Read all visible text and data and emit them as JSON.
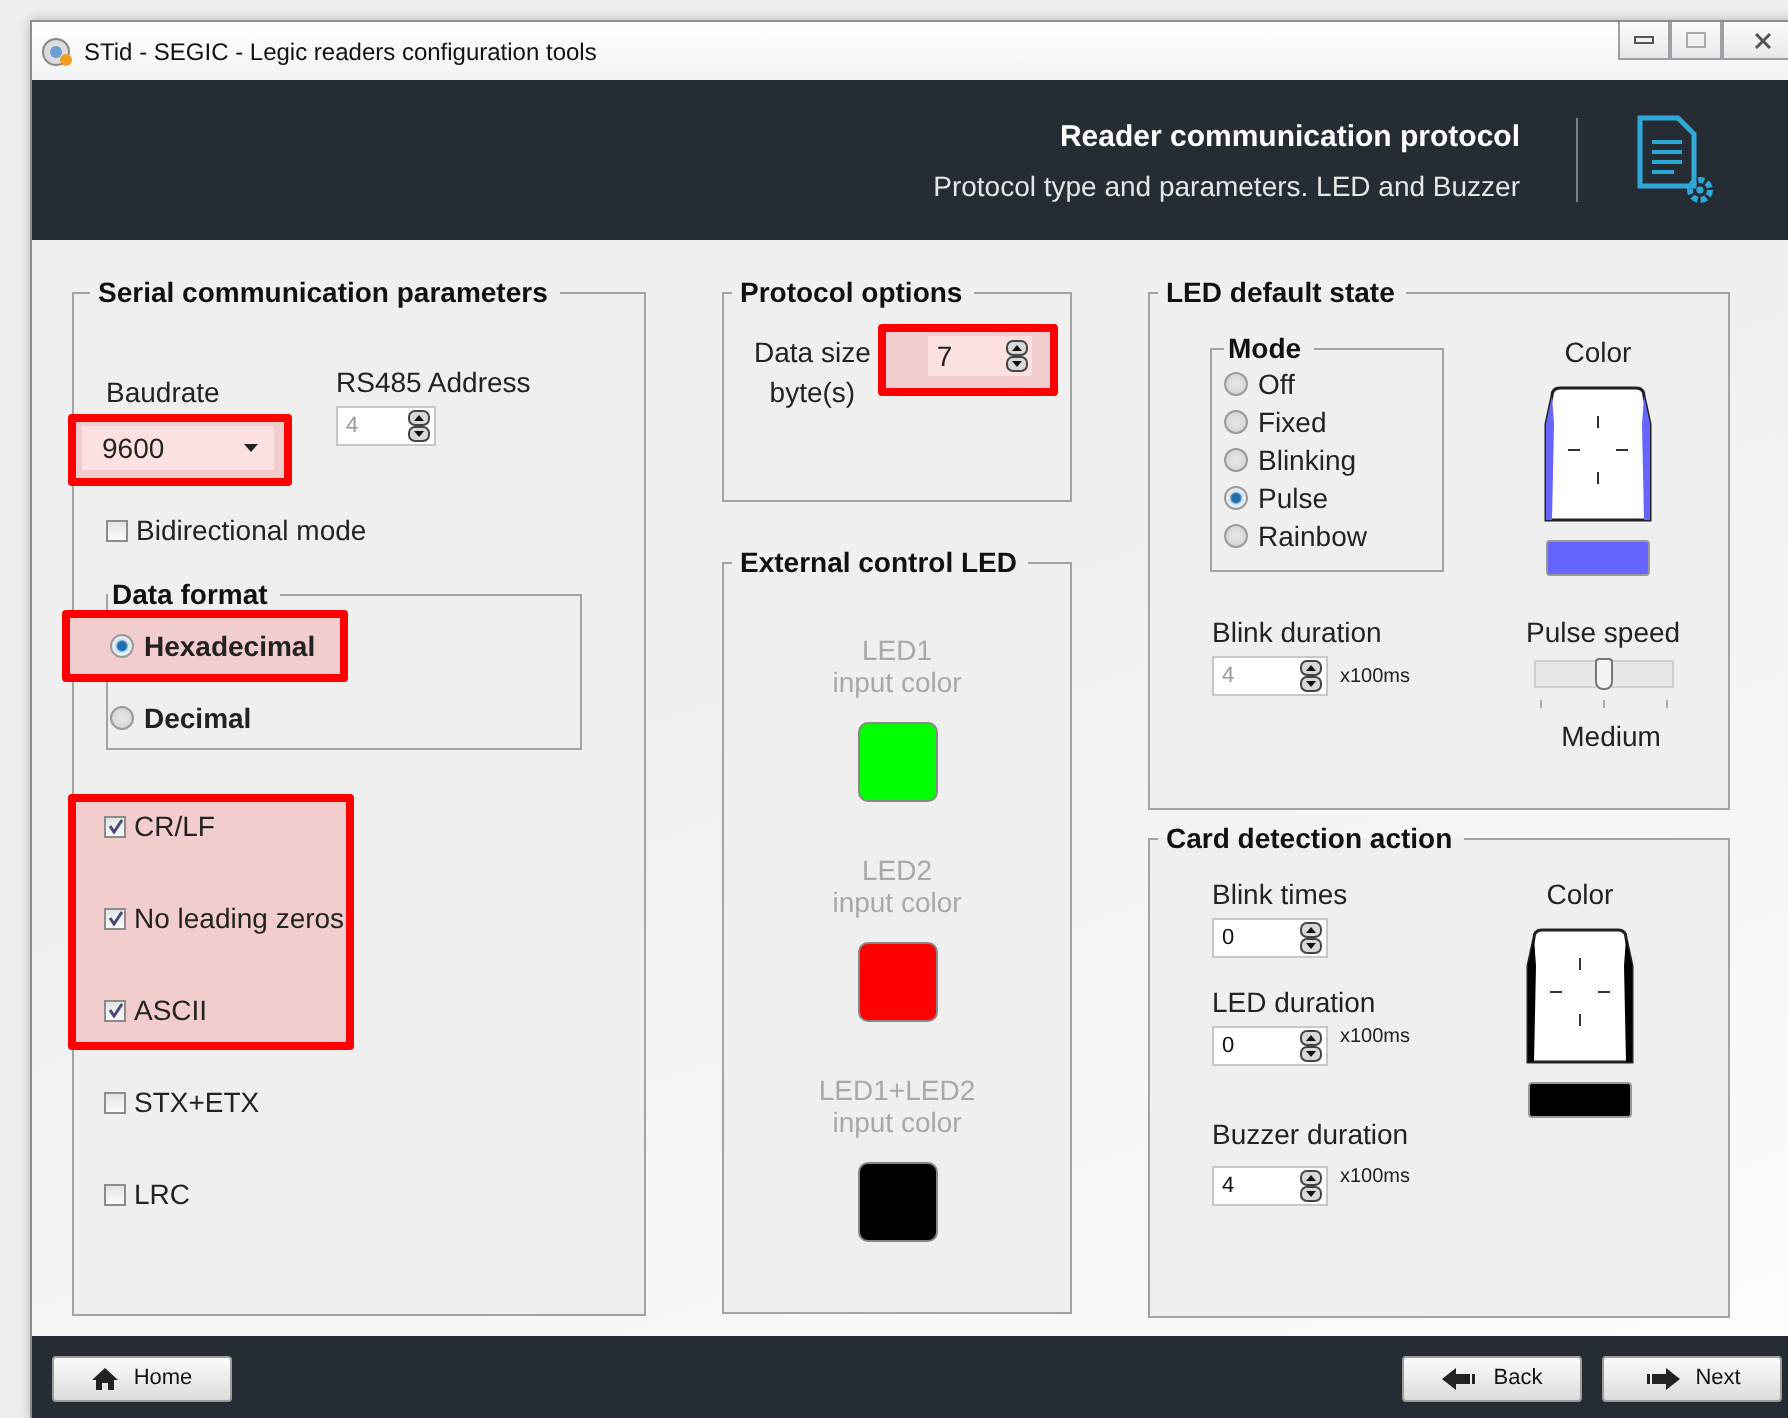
{
  "window": {
    "title": "STid - SEGIC - Legic readers configuration tools"
  },
  "header": {
    "title": "Reader communication protocol",
    "subtitle": "Protocol type and parameters. LED and Buzzer"
  },
  "serial": {
    "title": "Serial communication parameters",
    "baudrate": {
      "label": "Baudrate",
      "value": "9600",
      "highlighted": true
    },
    "rs485": {
      "label": "RS485 Address",
      "value": "4",
      "disabled": true
    },
    "bidirectional": {
      "label": "Bidirectional mode",
      "checked": false
    },
    "data_format": {
      "title": "Data format",
      "options": [
        {
          "label": "Hexadecimal",
          "selected": true,
          "highlighted": true
        },
        {
          "label": "Decimal",
          "selected": false,
          "highlighted": false
        }
      ]
    },
    "options": [
      {
        "label": "CR/LF",
        "checked": true,
        "highlighted": true
      },
      {
        "label": "No leading zeros",
        "checked": true,
        "highlighted": true
      },
      {
        "label": "ASCII",
        "checked": true,
        "highlighted": true
      },
      {
        "label": "STX+ETX",
        "checked": false,
        "highlighted": false
      },
      {
        "label": "LRC",
        "checked": false,
        "highlighted": false
      }
    ]
  },
  "protocol_options": {
    "title": "Protocol options",
    "data_size": {
      "label": "Data size",
      "unit": "byte(s)",
      "value": "7",
      "highlighted": true
    }
  },
  "external_led": {
    "title": "External control LED",
    "items": [
      {
        "label": "LED1",
        "sublabel": "input color",
        "color": "#00ff00"
      },
      {
        "label": "LED2",
        "sublabel": "input color",
        "color": "#ff0000"
      },
      {
        "label": "LED1+LED2",
        "sublabel": "input color",
        "color": "#000000"
      }
    ]
  },
  "led_default": {
    "title": "LED default state",
    "mode": {
      "title": "Mode",
      "options": [
        {
          "label": "Off",
          "selected": false
        },
        {
          "label": "Fixed",
          "selected": false
        },
        {
          "label": "Blinking",
          "selected": false
        },
        {
          "label": "Pulse",
          "selected": true
        },
        {
          "label": "Rainbow",
          "selected": false
        }
      ]
    },
    "color_label": "Color",
    "color": "#6666ff",
    "blink_duration": {
      "label": "Blink duration",
      "value": "4",
      "unit": "x100ms",
      "disabled": true
    },
    "pulse_speed": {
      "label": "Pulse speed",
      "level": 0.5,
      "reading": "Medium"
    }
  },
  "card_detection": {
    "title": "Card detection action",
    "blink_times": {
      "label": "Blink times",
      "value": "0",
      "disabled": false
    },
    "led_duration": {
      "label": "LED duration",
      "value": "0",
      "unit": "x100ms",
      "disabled": false
    },
    "buzzer_duration": {
      "label": "Buzzer duration",
      "value": "4",
      "unit": "x100ms",
      "disabled": false
    },
    "color_label": "Color",
    "color": "#000000"
  },
  "footer": {
    "buttons": [
      {
        "label": "Home",
        "kind": "home"
      },
      {
        "label": "Back",
        "kind": "back"
      },
      {
        "label": "Next",
        "kind": "next"
      }
    ]
  }
}
